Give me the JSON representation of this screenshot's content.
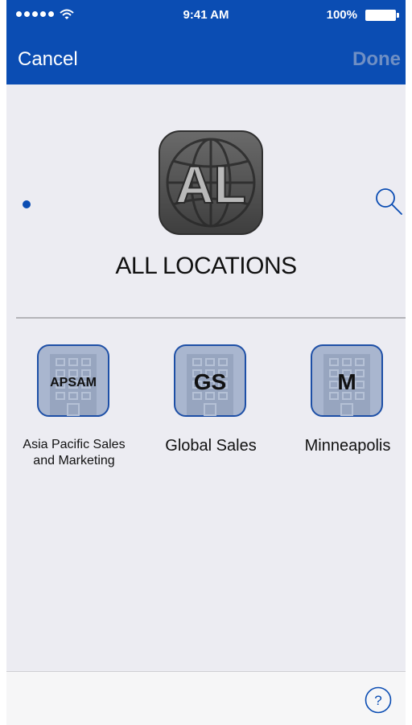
{
  "status": {
    "time": "9:41 AM",
    "battery": "100%"
  },
  "nav": {
    "cancel": "Cancel",
    "done": "Done"
  },
  "hero": {
    "badge": "AL",
    "label": "ALL LOCATIONS"
  },
  "locations": [
    {
      "code": "APSAM",
      "name_line1": "Asia Pacific Sales",
      "name_line2": "and Marketing"
    },
    {
      "code": "GS",
      "name": "Global Sales"
    },
    {
      "code": "M",
      "name": "Minneapolis"
    }
  ],
  "colors": {
    "accent": "#0b4db3",
    "background": "#ececf2"
  },
  "icons": [
    "search-icon",
    "help-icon",
    "globe-icon",
    "building-icon",
    "wifi-icon",
    "battery-icon"
  ]
}
